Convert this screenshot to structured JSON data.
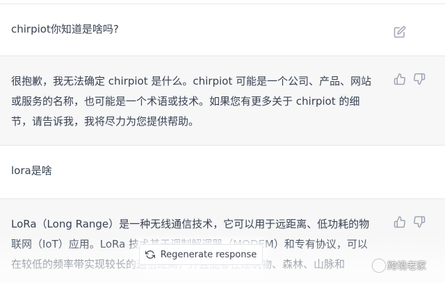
{
  "messages": [
    {
      "role": "user",
      "text": "chirpiot你知道是啥吗?"
    },
    {
      "role": "assistant",
      "text": "很抱歉，我无法确定 chirpiot 是什么。chirpiot 可能是一个公司、产品、网站\n或服务的名称，也可能是一个术语或技术。如果您有更多关于 chirpiot 的细\n节，请告诉我，我将尽力为您提供帮助。"
    },
    {
      "role": "user",
      "text": "lora是啥"
    },
    {
      "role": "assistant",
      "text": "LoRa（Long Range）是一种无线通信技术，它可以用于远距离、低功耗的物\n联网（IoT）应用。LoRa 技术基于调制解调器（MODEM）和专有协议，可以\n在较低的频率带实现较长的通信距离，并且能够在建筑物、森林、山脉和"
    }
  ],
  "regenerate": {
    "label": "Regenerate response",
    "icon": "refresh-icon"
  },
  "watermark": {
    "text": "跨境老家"
  },
  "icons": {
    "edit": "edit-icon",
    "thumbs_up": "thumbs-up-icon",
    "thumbs_down": "thumbs-down-icon"
  },
  "colors": {
    "assistant_bg": "#f7f7f8",
    "text": "#374151",
    "icon": "#9ca3af"
  }
}
